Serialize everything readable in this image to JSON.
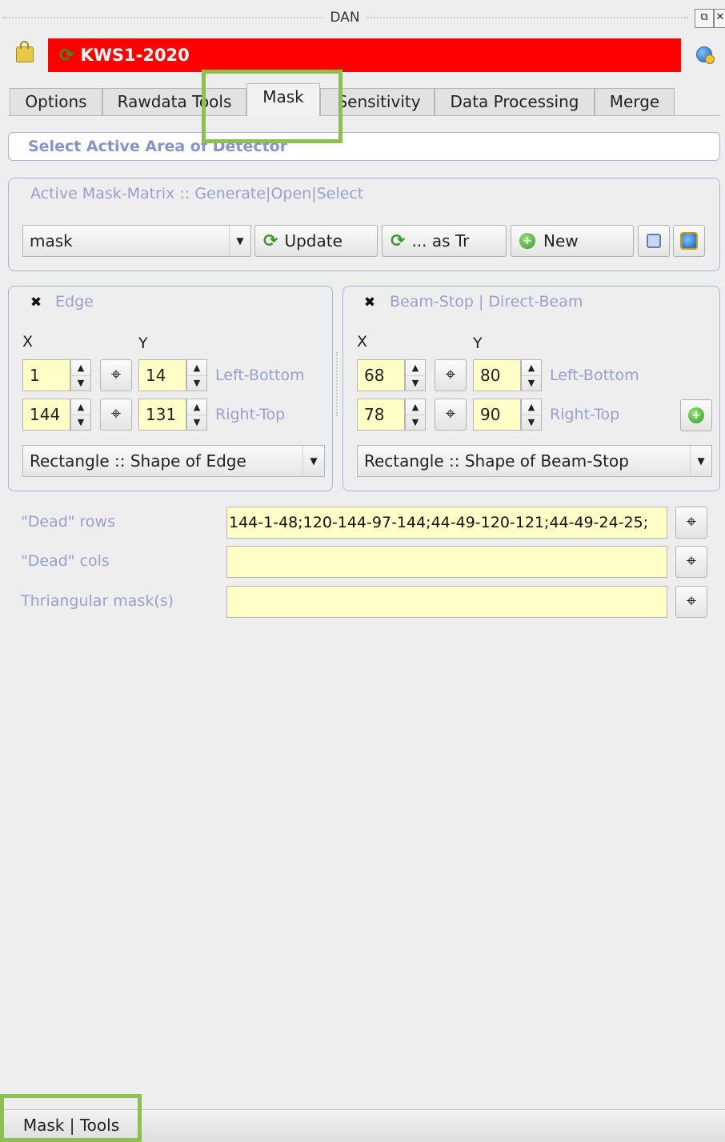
{
  "window": {
    "title": "DAN"
  },
  "header": {
    "instrument": "KWS1-2020"
  },
  "tabs": [
    {
      "label": "Options"
    },
    {
      "label": "Rawdata Tools"
    },
    {
      "label": "Mask"
    },
    {
      "label": "Sensitivity"
    },
    {
      "label": "Data Processing"
    },
    {
      "label": "Merge"
    }
  ],
  "page": {
    "title": "Select Active Area of Detector"
  },
  "mask_matrix": {
    "title": "Active Mask-Matrix :: Generate|Open|Select",
    "selected": "mask",
    "update_label": "Update",
    "as_tr_label": "... as Tr",
    "new_label": "New"
  },
  "edge": {
    "title": "Edge",
    "checked": true,
    "x_label": "X",
    "y_label": "Y",
    "left_bottom": {
      "x": "1",
      "y": "14",
      "label": "Left-Bottom"
    },
    "right_top": {
      "x": "144",
      "y": "131",
      "label": "Right-Top"
    },
    "shape": "Rectangle :: Shape of Edge"
  },
  "beamstop": {
    "title": "Beam-Stop | Direct-Beam",
    "checked": true,
    "x_label": "X",
    "y_label": "Y",
    "left_bottom": {
      "x": "68",
      "y": "80",
      "label": "Left-Bottom"
    },
    "right_top": {
      "x": "78",
      "y": "90",
      "label": "Right-Top"
    },
    "shape": "Rectangle :: Shape of Beam-Stop"
  },
  "dead": {
    "rows_label": "\"Dead\" rows",
    "rows_value": "144-1-48;120-144-97-144;44-49-120-121;44-49-24-25;",
    "cols_label": "\"Dead\" cols",
    "cols_value": "",
    "tri_label": "Thriangular mask(s)",
    "tri_value": ""
  },
  "bottom": {
    "tab_label": "Mask | Tools"
  },
  "colors": {
    "header_red": "#ff0000",
    "highlight_green": "#8cc152",
    "field_yellow": "#ffffc8",
    "label_blue": "#9aa0cc"
  }
}
